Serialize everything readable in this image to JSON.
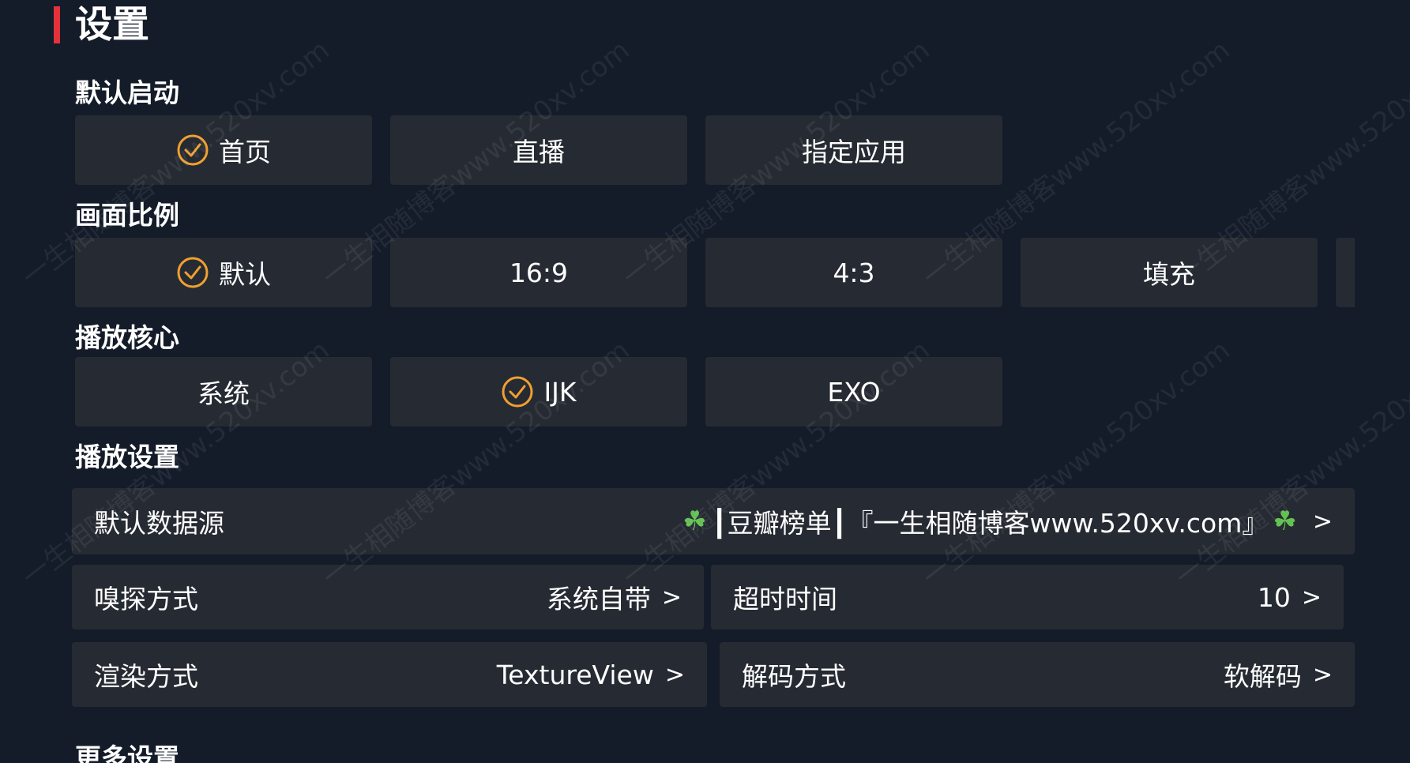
{
  "page": {
    "title": "设置"
  },
  "sections": {
    "default_start": {
      "label": "默认启动",
      "options": [
        {
          "label": "首页",
          "selected": true
        },
        {
          "label": "直播",
          "selected": false
        },
        {
          "label": "指定应用",
          "selected": false
        }
      ]
    },
    "aspect_ratio": {
      "label": "画面比例",
      "options": [
        {
          "label": "默认",
          "selected": true
        },
        {
          "label": "16:9",
          "selected": false
        },
        {
          "label": "4:3",
          "selected": false
        },
        {
          "label": "填充",
          "selected": false
        }
      ]
    },
    "play_core": {
      "label": "播放核心",
      "options": [
        {
          "label": "系统",
          "selected": false
        },
        {
          "label": "IJK",
          "selected": true
        },
        {
          "label": "EXO",
          "selected": false
        }
      ]
    },
    "play_settings": {
      "label": "播放设置",
      "rows": {
        "default_source": {
          "label": "默认数据源",
          "value_prefix": "┃豆瓣榜单┃『一生相随博客www.520xv.com』",
          "chevron": ">"
        },
        "sniff_mode": {
          "label": "嗅探方式",
          "value": "系统自带",
          "chevron": ">"
        },
        "timeout": {
          "label": "超时时间",
          "value": "10",
          "chevron": ">"
        },
        "render_mode": {
          "label": "渲染方式",
          "value": "TextureView",
          "chevron": ">"
        },
        "decode_mode": {
          "label": "解码方式",
          "value": "软解码",
          "chevron": ">"
        }
      }
    },
    "more_settings": {
      "label": "更多设置"
    }
  },
  "icons": {
    "check": "check-circle-icon",
    "clover": "clover-icon"
  },
  "colors": {
    "background": "#141b29",
    "card": "#262b33",
    "accent": "#f0a030",
    "title_bar": "#e5323a",
    "clover": "#63c152"
  },
  "watermark": "一生相随博客www.520xv.com"
}
